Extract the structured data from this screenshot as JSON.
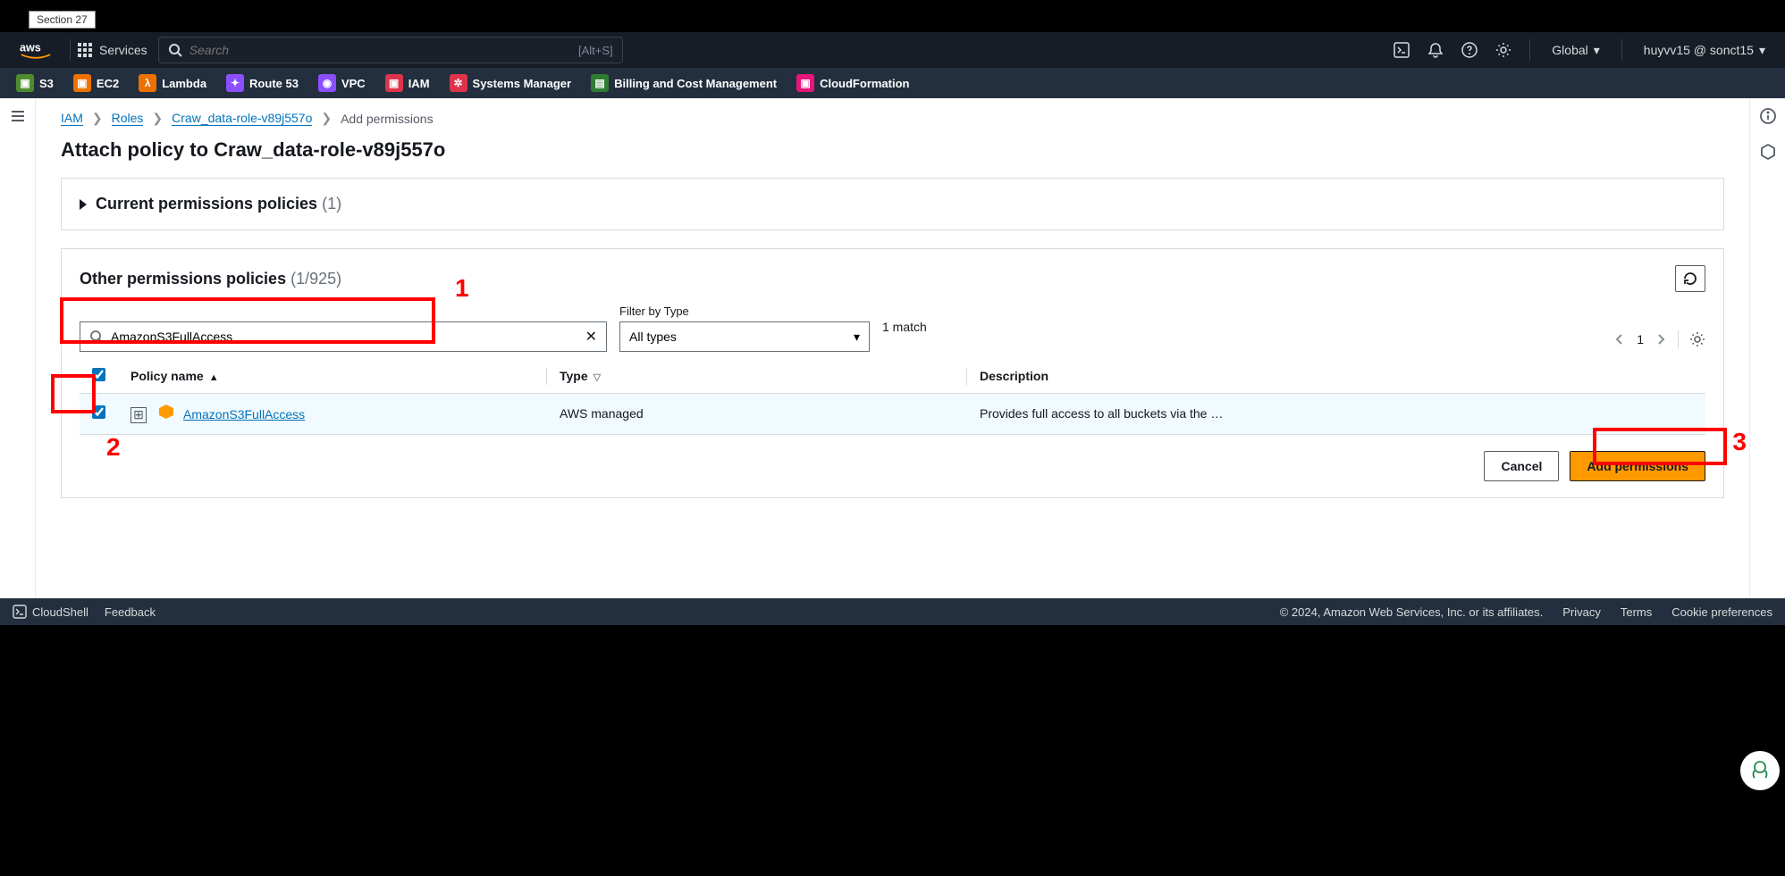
{
  "section_tab": "Section 27",
  "topnav": {
    "services": "Services",
    "search_placeholder": "Search",
    "search_hint": "[Alt+S]",
    "region": "Global",
    "account": "huyvv15 @ sonct15"
  },
  "favorites": [
    {
      "label": "S3",
      "color": "#4f8c2f"
    },
    {
      "label": "EC2",
      "color": "#ed7100"
    },
    {
      "label": "Lambda",
      "color": "#ed7100"
    },
    {
      "label": "Route 53",
      "color": "#8c4fff"
    },
    {
      "label": "VPC",
      "color": "#8c4fff"
    },
    {
      "label": "IAM",
      "color": "#dd344c"
    },
    {
      "label": "Systems Manager",
      "color": "#dd344c"
    },
    {
      "label": "Billing and Cost Management",
      "color": "#2e7d32"
    },
    {
      "label": "CloudFormation",
      "color": "#e7157b"
    }
  ],
  "breadcrumb": {
    "items": [
      "IAM",
      "Roles",
      "Craw_data-role-v89j557o"
    ],
    "current": "Add permissions"
  },
  "page_title": "Attach policy to Craw_data-role-v89j557o",
  "current_panel": {
    "title": "Current permissions policies",
    "count": "(1)"
  },
  "other_panel": {
    "title": "Other permissions policies",
    "count": "(1/925)",
    "filter_type_label": "Filter by Type",
    "filter_type_value": "All types",
    "search_value": "AmazonS3FullAccess",
    "match_text": "1 match",
    "page": "1",
    "columns": {
      "policy": "Policy name",
      "type": "Type",
      "description": "Description"
    },
    "rows": [
      {
        "name": "AmazonS3FullAccess",
        "type": "AWS managed",
        "description": "Provides full access to all buckets via the …",
        "selected": true
      }
    ]
  },
  "actions": {
    "cancel": "Cancel",
    "add": "Add permissions"
  },
  "bottombar": {
    "cloudshell": "CloudShell",
    "feedback": "Feedback",
    "copyright": "© 2024, Amazon Web Services, Inc. or its affiliates.",
    "links": [
      "Privacy",
      "Terms",
      "Cookie preferences"
    ]
  },
  "annotations": {
    "n1": "1",
    "n2": "2",
    "n3": "3"
  }
}
